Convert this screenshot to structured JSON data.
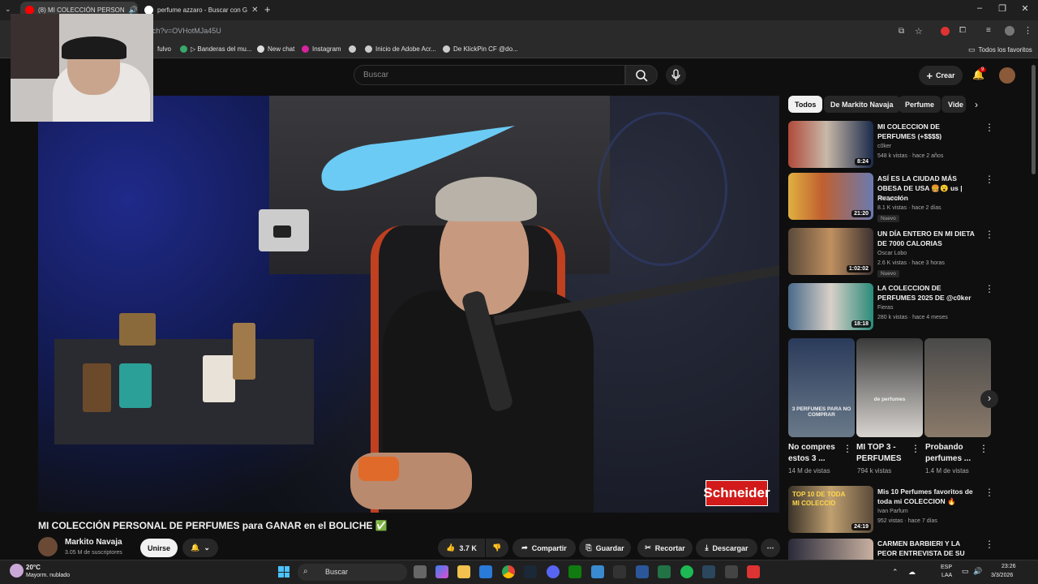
{
  "browser": {
    "tabs": [
      {
        "label": "(8) MI COLECCIÓN PERSON",
        "active": true
      },
      {
        "label": "perfume azzaro - Buscar con G",
        "active": false
      }
    ],
    "new_tab": "+",
    "url": "ch?v=OVHotMJa45U",
    "bookmarks": [
      "fulvo",
      "▷ Banderas del mu...",
      "New chat",
      "Instagram",
      "Inicio de Adobe Acr...",
      "De KlickPin CF @do..."
    ],
    "all_bookmarks": "Todos los favoritos"
  },
  "youtube": {
    "search_placeholder": "Buscar",
    "create_label": "Crear",
    "notif_count": "9"
  },
  "video": {
    "title": "MI COLECCIÓN PERSONAL DE PERFUMES para GANAR en el BOLICHE ✅",
    "brand_overlay": "Schneider",
    "channel": "Markito Navaja",
    "subscribers": "3.05 M de suscriptores",
    "join_label": "Unirse",
    "likes": "3.7 K",
    "share_label": "Compartir",
    "save_label": "Guardar",
    "clip_label": "Recortar",
    "download_label": "Descargar"
  },
  "chips": [
    "Todos",
    "De Markito Navaja",
    "Perfume",
    "Vide"
  ],
  "related": [
    {
      "title": "MI COLECCION DE PERFUMES (+$$$$)",
      "channel": "c0ker",
      "meta": "548 k vistas · hace 2 años",
      "duration": "8:24",
      "badge": ""
    },
    {
      "title": "ASÍ ES LA CIUDAD MÁS OBESA DE USA 🍔😮 us | Reacción",
      "channel": "Harryson",
      "meta": "8.1 K vistas · hace 2 días",
      "duration": "21:20",
      "badge": "Nuevo"
    },
    {
      "title": "UN DÍA ENTERO EN MI DIETA DE 7000 CALORIAS",
      "channel": "Oscar Lobo",
      "meta": "2.6 K vistas · hace 3 horas",
      "duration": "1:02:02",
      "badge": "Nuevo"
    },
    {
      "title": "LA COLECCION DE PERFUMES 2025 DE @c0ker",
      "channel": "Fieras",
      "meta": "280 k vistas · hace 4 meses",
      "duration": "18:18",
      "badge": ""
    }
  ],
  "shorts": [
    {
      "title": "No compres estos 3 ...",
      "views": "14 M de vistas",
      "overlay": "3 PERFUMES PARA NO COMPRAR"
    },
    {
      "title": "MI TOP 3 - PERFUMES",
      "views": "794 k vistas",
      "overlay": "de perfumes"
    },
    {
      "title": "Probando perfumes ...",
      "views": "1.4 M de vistas",
      "overlay": ""
    }
  ],
  "related2": [
    {
      "title": "Mis 10 Perfumes favoritos de toda mi COLECCION 🔥",
      "channel": "Ivan Parfum",
      "meta": "952 vistas · hace 7 días",
      "duration": "24:19",
      "overlay": "TOP 10 DE TODA MI COLECCIO"
    },
    {
      "title": "CARMEN BARBIERI Y LA PEOR ENTREVISTA DE SU VIDA",
      "channel": "",
      "meta": "",
      "duration": "",
      "overlay": ""
    }
  ],
  "taskbar": {
    "weather_temp": "20°C",
    "weather_desc": "Mayorm. nublado",
    "search": "Buscar",
    "lang1": "ESP",
    "lang2": "LAA",
    "time": "23:26",
    "date": "3/3/2026"
  }
}
